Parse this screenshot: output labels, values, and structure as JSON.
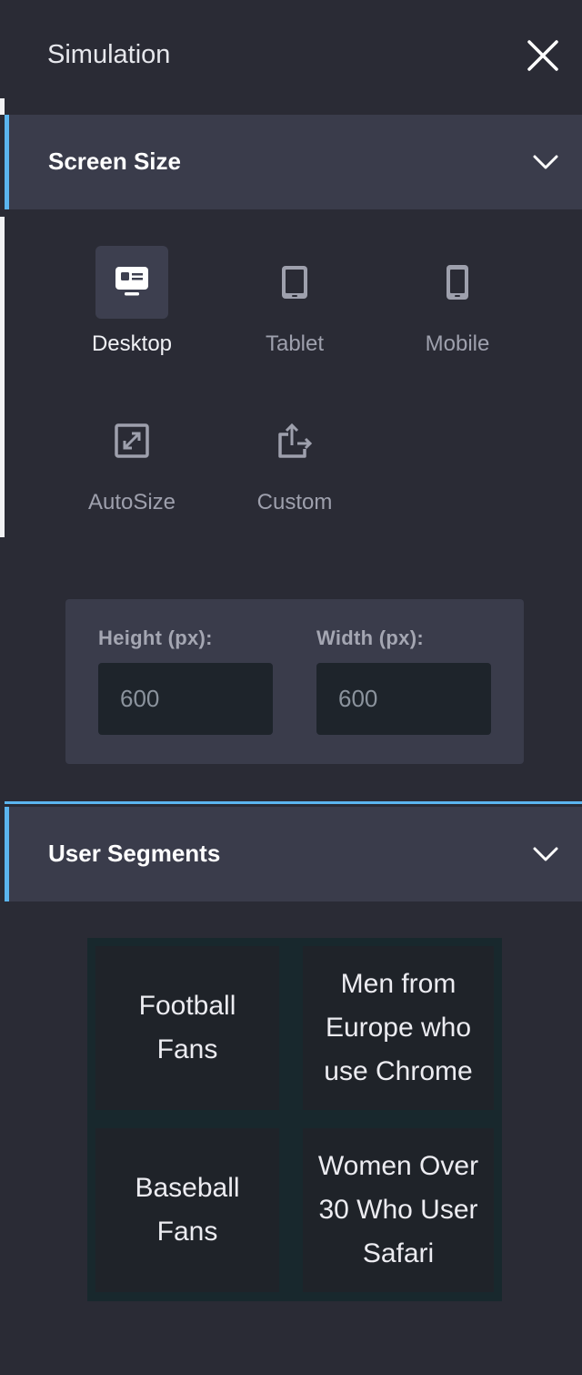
{
  "header": {
    "title": "Simulation"
  },
  "screen_size": {
    "label": "Screen Size",
    "devices": [
      {
        "label": "Desktop",
        "icon": "desktop-icon",
        "active": true
      },
      {
        "label": "Tablet",
        "icon": "tablet-icon",
        "active": false
      },
      {
        "label": "Mobile",
        "icon": "mobile-icon",
        "active": false
      },
      {
        "label": "AutoSize",
        "icon": "autosize-icon",
        "active": false
      },
      {
        "label": "Custom",
        "icon": "custom-share-icon",
        "active": false
      }
    ],
    "height_label": "Height (px):",
    "height_placeholder": "600",
    "width_label": "Width (px):",
    "width_placeholder": "600"
  },
  "user_segments": {
    "label": "User Segments",
    "items": [
      {
        "label": "Football Fans"
      },
      {
        "label": "Men from Europe who use Chrome"
      },
      {
        "label": "Baseball Fans"
      },
      {
        "label": "Women Over 30 Who User Safari"
      }
    ]
  },
  "colors": {
    "accent": "#5bb5ef",
    "background": "#2a2b35",
    "section": "#3a3c4b"
  }
}
